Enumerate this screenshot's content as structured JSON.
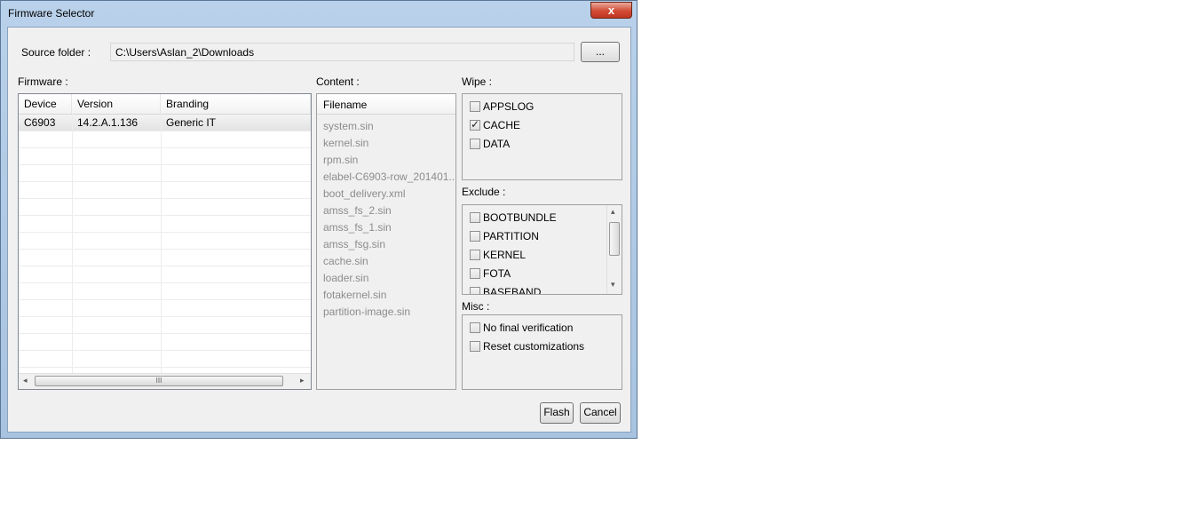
{
  "window": {
    "title": "Firmware Selector",
    "close_label": "x"
  },
  "source": {
    "label": "Source folder :",
    "path": "C:\\Users\\Aslan_2\\Downloads",
    "browse_label": "..."
  },
  "firmware": {
    "label": "Firmware :",
    "columns": [
      "Device",
      "Version",
      "Branding"
    ],
    "rows": [
      {
        "device": "C6903",
        "version": "14.2.A.1.136",
        "branding": "Generic IT"
      }
    ],
    "scroll_grip": "III"
  },
  "content": {
    "label": "Content :",
    "header": "Filename",
    "files": [
      "system.sin",
      "kernel.sin",
      "rpm.sin",
      "elabel-C6903-row_201401...",
      "boot_delivery.xml",
      "amss_fs_2.sin",
      "amss_fs_1.sin",
      "amss_fsg.sin",
      "cache.sin",
      "loader.sin",
      "fotakernel.sin",
      "partition-image.sin"
    ]
  },
  "wipe": {
    "label": "Wipe :",
    "items": [
      {
        "label": "APPSLOG",
        "checked": false
      },
      {
        "label": "CACHE",
        "checked": true
      },
      {
        "label": "DATA",
        "checked": false
      }
    ]
  },
  "exclude": {
    "label": "Exclude :",
    "items": [
      {
        "label": "BOOTBUNDLE",
        "checked": false
      },
      {
        "label": "PARTITION",
        "checked": false
      },
      {
        "label": "KERNEL",
        "checked": false
      },
      {
        "label": "FOTA",
        "checked": false
      },
      {
        "label": "BASEBAND",
        "checked": false
      }
    ]
  },
  "misc": {
    "label": "Misc :",
    "items": [
      {
        "label": "No final verification",
        "checked": false
      },
      {
        "label": "Reset customizations",
        "checked": false
      }
    ]
  },
  "actions": {
    "flash_label": "Flash",
    "cancel_label": "Cancel"
  }
}
